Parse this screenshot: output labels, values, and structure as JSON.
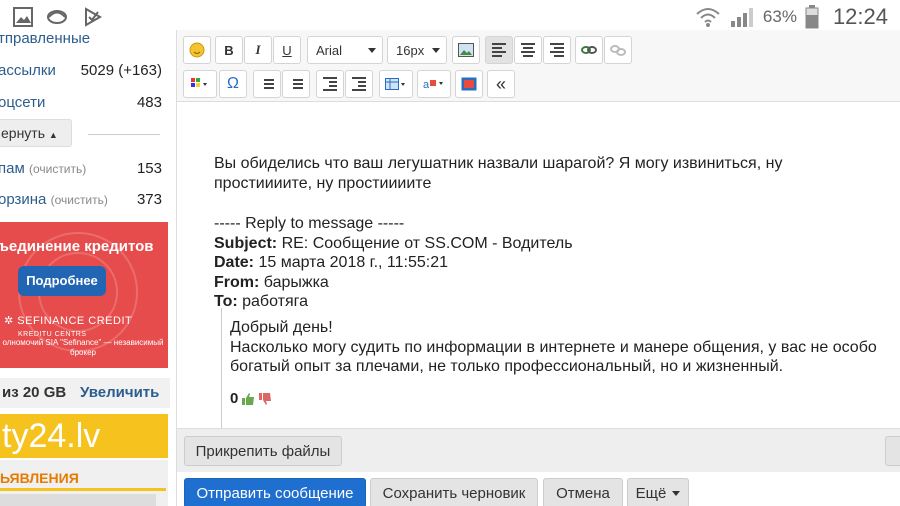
{
  "status_bar": {
    "battery_percent": "63%",
    "time": "12:24",
    "icons": [
      "gallery-icon",
      "sync-icon",
      "tasks-icon",
      "wifi-icon",
      "signal-icon",
      "battery-icon"
    ]
  },
  "sidebar": {
    "items": [
      {
        "label": "тправленные",
        "count": ""
      },
      {
        "label": "ассылки",
        "count": "5029 (+163)"
      },
      {
        "label": "оцсети",
        "count": "483"
      }
    ],
    "collapse_label": "ернуть",
    "folders": [
      {
        "label": "пам",
        "clear": "(очистить)",
        "count": "153"
      },
      {
        "label": "орзина",
        "clear": "(очистить)",
        "count": "373"
      }
    ],
    "ad_credit": {
      "title": "ъединение кредитов",
      "button": "Подробнее",
      "brand": "SEFINANCE CREDIT",
      "brand_sub": "KREDITU CENTRS",
      "note": "олномочий SIA \"Sefinance\" — независимый брокер"
    },
    "quota": {
      "text": "из 20 GB",
      "increase": "Увеличить"
    },
    "ad_logo": "ty24.lv",
    "ad_ads_title": "ЬЯВЛЕНИЯ"
  },
  "toolbar": {
    "font_family": "Arial",
    "font_size": "16px",
    "buttons": [
      "emoji-icon",
      "bold",
      "italic",
      "underline",
      "image",
      "align-left",
      "align-center",
      "align-right",
      "link",
      "unlink",
      "color",
      "special-char",
      "ordered-list",
      "unordered-list",
      "outdent",
      "indent",
      "table",
      "font-color",
      "insert",
      "collapse"
    ],
    "bold_label": "B",
    "italic_label": "I",
    "underline_label": "U",
    "omega_label": "Ω",
    "collapse_label": "«"
  },
  "message": {
    "line1": "Вы обиделись что ваш легушатник назвали шарагой? Я могу извиниться, ну",
    "line2": "простиииите, ну простиииите",
    "reply_sep": "----- Reply to message -----",
    "subject_label": "Subject:",
    "subject": " RE: Сообщение от SS.COM - Водитель",
    "date_label": "Date:",
    "date": " 15 марта 2018 г., 11:55:21",
    "from_label": "From:",
    "from": " барыжка",
    "to_label": "To:",
    "to": " работяга",
    "quote_line1": "Добрый день!",
    "quote_line2": "Насколько могу судить по информации в интернете и манере общения, у вас не особо",
    "quote_line3": "богатый опыт за плечами, не только профессиональный, но и жизненный.",
    "rating": "0"
  },
  "actions": {
    "attach": "Прикрепить файлы",
    "send": "Отправить сообщение",
    "save_draft": "Сохранить черновик",
    "cancel": "Отмена",
    "more": "Ещё"
  }
}
